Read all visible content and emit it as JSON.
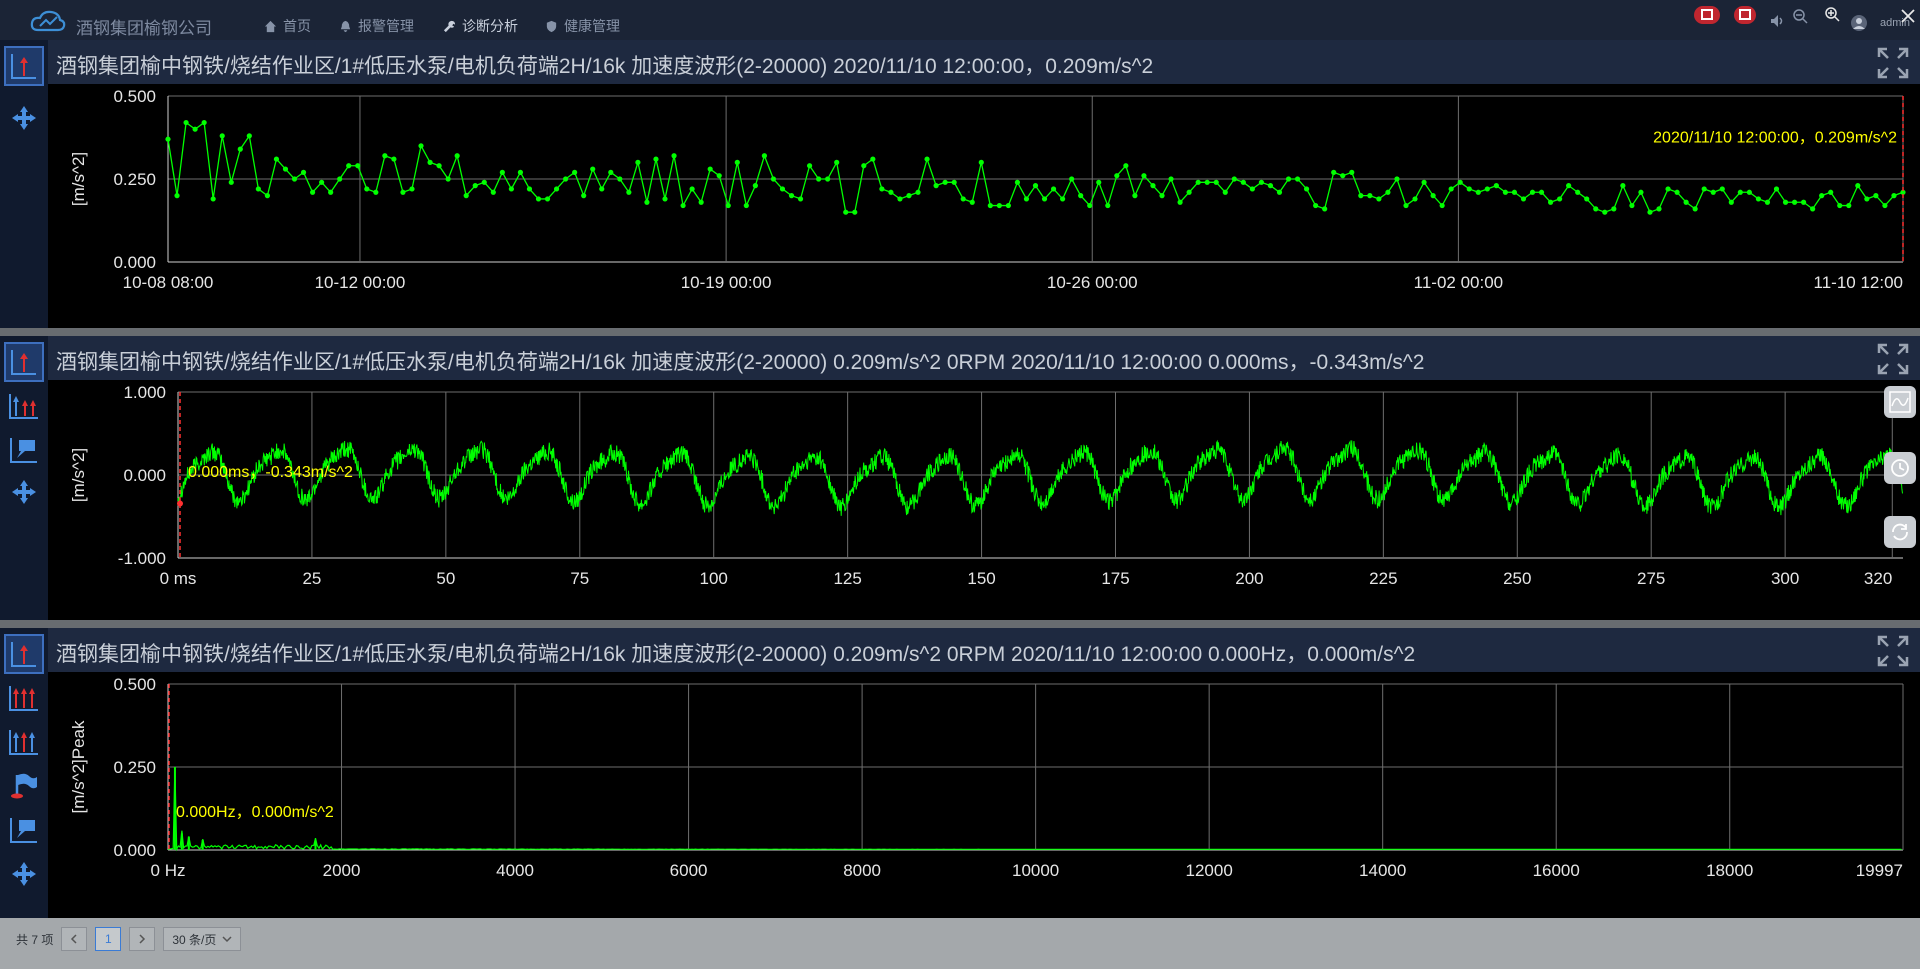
{
  "app": {
    "title": "酒钢集团榆钢公司"
  },
  "nav": [
    {
      "label": "首页",
      "icon": "home-icon"
    },
    {
      "label": "报警管理",
      "icon": "bell-icon"
    },
    {
      "label": "诊断分析",
      "icon": "wrench-icon",
      "active": true
    },
    {
      "label": "健康管理",
      "icon": "shield-icon"
    }
  ],
  "user": {
    "name": "admin"
  },
  "panels": {
    "trend": {
      "title": "酒钢集团榆中钢铁/烧结作业区/1#低压水泵/电机负荷端2H/16k 加速度波形(2-20000) 2020/11/10 12:00:00，0.209m/s^2",
      "cursor_label": "2020/11/10 12:00:00，0.209m/s^2"
    },
    "waveform": {
      "title": "酒钢集团榆中钢铁/烧结作业区/1#低压水泵/电机负荷端2H/16k 加速度波形(2-20000) 0.209m/s^2 0RPM 2020/11/10 12:00:00 0.000ms，-0.343m/s^2",
      "cursor_label": "0.000ms，-0.343m/s^2"
    },
    "spectrum": {
      "title": "酒钢集团榆中钢铁/烧结作业区/1#低压水泵/电机负荷端2H/16k 加速度波形(2-20000) 0.209m/s^2 0RPM 2020/11/10 12:00:00 0.000Hz，0.000m/s^2",
      "cursor_label": "0.000Hz，0.000m/s^2"
    }
  },
  "footer": {
    "total": "共 7 项",
    "current_page": "1",
    "page_size": "30 条/页"
  },
  "colors": {
    "trace": "#00ff00",
    "cursor": "#ff3030",
    "label": "#ffff00",
    "grid": "#6e6e6e"
  },
  "chart_data": [
    {
      "type": "line",
      "ylabel": "[m/s^2]",
      "ylim": [
        0,
        0.5
      ],
      "yticks": [
        "0.000",
        "0.250",
        "0.500"
      ],
      "xticks": [
        "10-08 08:00",
        "10-12 00:00",
        "10-19 00:00",
        "10-26 00:00",
        "11-02 00:00",
        "11-10 12:00"
      ],
      "x_range_days": [
        0,
        33.17
      ],
      "xtick_days": [
        0,
        3.67,
        10.67,
        17.67,
        24.67,
        33.17
      ],
      "values": [
        0.37,
        0.2,
        0.42,
        0.4,
        0.42,
        0.19,
        0.38,
        0.24,
        0.34,
        0.38,
        0.22,
        0.2,
        0.31,
        0.28,
        0.25,
        0.27,
        0.21,
        0.24,
        0.21,
        0.25,
        0.29,
        0.29,
        0.22,
        0.21,
        0.32,
        0.31,
        0.21,
        0.22,
        0.35,
        0.3,
        0.29,
        0.25,
        0.32,
        0.2,
        0.23,
        0.24,
        0.21,
        0.27,
        0.22,
        0.27,
        0.22,
        0.19,
        0.19,
        0.22,
        0.25,
        0.27,
        0.2,
        0.28,
        0.22,
        0.27,
        0.25,
        0.21,
        0.3,
        0.18,
        0.31,
        0.19,
        0.32,
        0.17,
        0.22,
        0.18,
        0.28,
        0.26,
        0.17,
        0.3,
        0.17,
        0.23,
        0.32,
        0.25,
        0.22,
        0.2,
        0.19,
        0.29,
        0.25,
        0.25,
        0.3,
        0.15,
        0.15,
        0.29,
        0.31,
        0.22,
        0.21,
        0.19,
        0.2,
        0.21,
        0.31,
        0.23,
        0.24,
        0.24,
        0.19,
        0.18,
        0.3,
        0.17,
        0.17,
        0.17,
        0.24,
        0.19,
        0.23,
        0.19,
        0.22,
        0.19,
        0.25,
        0.2,
        0.17,
        0.24,
        0.17,
        0.26,
        0.29,
        0.2,
        0.26,
        0.23,
        0.2,
        0.25,
        0.18,
        0.21,
        0.24,
        0.24,
        0.24,
        0.21,
        0.25,
        0.24,
        0.22,
        0.24,
        0.23,
        0.21,
        0.25,
        0.25,
        0.22,
        0.17,
        0.16,
        0.27,
        0.26,
        0.27,
        0.2,
        0.2,
        0.19,
        0.21,
        0.25,
        0.17,
        0.19,
        0.24,
        0.2,
        0.17,
        0.22,
        0.24,
        0.22,
        0.21,
        0.22,
        0.23,
        0.21,
        0.21,
        0.19,
        0.21,
        0.21,
        0.18,
        0.19,
        0.23,
        0.21,
        0.19,
        0.16,
        0.15,
        0.16,
        0.23,
        0.17,
        0.21,
        0.15,
        0.16,
        0.22,
        0.21,
        0.18,
        0.16,
        0.22,
        0.21,
        0.22,
        0.18,
        0.21,
        0.21,
        0.19,
        0.18,
        0.22,
        0.18,
        0.18,
        0.18,
        0.16,
        0.2,
        0.21,
        0.17,
        0.17,
        0.23,
        0.19,
        0.2,
        0.17,
        0.2,
        0.21
      ]
    },
    {
      "type": "line",
      "ylabel": "[m/s^2]",
      "ylim": [
        -1,
        1
      ],
      "yticks": [
        "-1.000",
        "0.000",
        "1.000"
      ],
      "xlim": [
        0,
        322
      ],
      "xticks": [
        "0 ms",
        "25",
        "50",
        "75",
        "100",
        "125",
        "150",
        "175",
        "200",
        "225",
        "250",
        "275",
        "300",
        "320"
      ],
      "xtick_values": [
        0,
        25,
        50,
        75,
        100,
        125,
        150,
        175,
        200,
        225,
        250,
        275,
        300,
        320
      ],
      "signal": {
        "frequency_hz": 80,
        "amplitude": 0.28,
        "cursor": {
          "x_ms": 0,
          "y": -0.343
        }
      }
    },
    {
      "type": "line",
      "ylabel": "[m/s^2]Peak",
      "ylim": [
        0,
        0.5
      ],
      "yticks": [
        "0.000",
        "0.250",
        "0.500"
      ],
      "xlim": [
        0,
        19997
      ],
      "xticks": [
        "0 Hz",
        "2000",
        "4000",
        "6000",
        "8000",
        "10000",
        "12000",
        "14000",
        "16000",
        "18000",
        "19997"
      ],
      "xtick_values": [
        0,
        2000,
        4000,
        6000,
        8000,
        10000,
        12000,
        14000,
        16000,
        18000,
        19997
      ],
      "peaks": [
        {
          "x": 80,
          "y": 0.25
        },
        {
          "x": 160,
          "y": 0.05
        },
        {
          "x": 240,
          "y": 0.04
        },
        {
          "x": 400,
          "y": 0.03
        },
        {
          "x": 1700,
          "y": 0.03
        }
      ]
    }
  ]
}
